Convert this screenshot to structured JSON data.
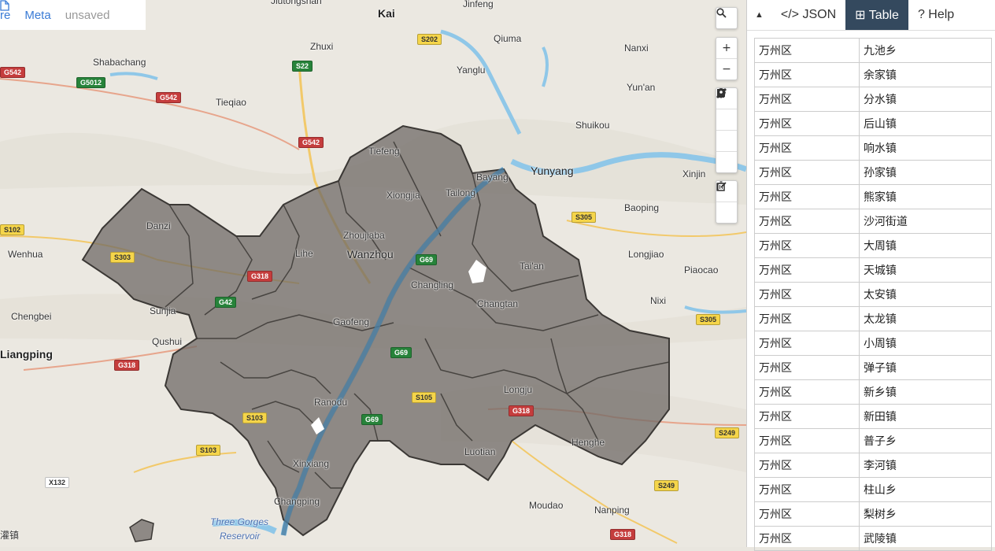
{
  "top_tabs": {
    "partial": "re",
    "meta": "Meta",
    "status": "unsaved"
  },
  "controls": {
    "search_icon": "search-icon",
    "zoom_in": "+",
    "zoom_out": "−"
  },
  "panel": {
    "toggle": "▲",
    "tabs": [
      {
        "label": "</> JSON"
      },
      {
        "label": "⊞ Table"
      },
      {
        "label": "? Help"
      }
    ],
    "rows": [
      [
        "万州区",
        "九池乡"
      ],
      [
        "万州区",
        "余家镇"
      ],
      [
        "万州区",
        "分水镇"
      ],
      [
        "万州区",
        "后山镇"
      ],
      [
        "万州区",
        "响水镇"
      ],
      [
        "万州区",
        "孙家镇"
      ],
      [
        "万州区",
        "熊家镇"
      ],
      [
        "万州区",
        "沙河街道"
      ],
      [
        "万州区",
        "大周镇"
      ],
      [
        "万州区",
        "天城镇"
      ],
      [
        "万州区",
        "太安镇"
      ],
      [
        "万州区",
        "太龙镇"
      ],
      [
        "万州区",
        "小周镇"
      ],
      [
        "万州区",
        "弹子镇"
      ],
      [
        "万州区",
        "新乡镇"
      ],
      [
        "万州区",
        "新田镇"
      ],
      [
        "万州区",
        "普子乡"
      ],
      [
        "万州区",
        "李河镇"
      ],
      [
        "万州区",
        "柱山乡"
      ],
      [
        "万州区",
        "梨树乡"
      ],
      [
        "万州区",
        "武陵镇"
      ]
    ]
  },
  "map": {
    "places": [
      "Jiutongshan",
      "Kai",
      "Jinfeng",
      "Zhuxi",
      "Shabachang",
      "Qiuma",
      "Nanxi",
      "Yanglu",
      "Tieqiao",
      "Yun'an",
      "Shuikou",
      "Tiefeng",
      "Bayang",
      "Yunyang",
      "Xinjin",
      "Xiongjia",
      "Tailong",
      "Danzi",
      "Baoping",
      "Wenhua",
      "Zhoujiaba",
      "Lihe",
      "Wanzhou",
      "Tai'an",
      "Longjiao",
      "Piaocao",
      "Changling",
      "Sunjia",
      "Changtan",
      "Nixi",
      "Chengbei",
      "Gaofeng",
      "Qushui",
      "Liangping",
      "Longju",
      "Ranodu",
      "Henghe",
      "Luotian",
      "Xinxiang",
      "Changping",
      "Moudao",
      "Nanping",
      "Three Gorges",
      "Reservoir",
      "灌镇"
    ],
    "shields": [
      "G542",
      "G5012",
      "G542",
      "S22",
      "S202",
      "G542",
      "S305",
      "S303",
      "G318",
      "G42",
      "G69",
      "G69",
      "S105",
      "S305",
      "G318",
      "S103",
      "G69",
      "S249",
      "S103",
      "X132",
      "S249",
      "G318",
      "S102",
      "G318"
    ]
  }
}
